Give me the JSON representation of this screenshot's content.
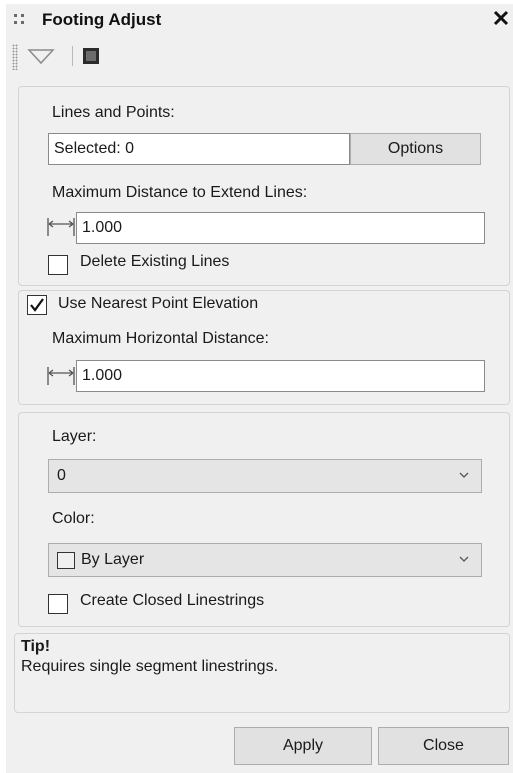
{
  "window": {
    "title": "Footing Adjust",
    "close_glyph": "✕"
  },
  "toolbar": {
    "icons": [
      "filter-triangle-icon",
      "image-icon"
    ]
  },
  "lines_points": {
    "label": "Lines and Points:",
    "selected_value": "Selected: 0",
    "options_label": "Options",
    "max_extend_label": "Maximum Distance to Extend Lines:",
    "max_extend_value": "1.000",
    "delete_label": "Delete Existing Lines",
    "delete_checked": false
  },
  "elevation": {
    "use_nearest_label": "Use Nearest Point Elevation",
    "use_nearest_checked": true,
    "max_horizontal_label": "Maximum Horizontal Distance:",
    "max_horizontal_value": "1.000"
  },
  "output": {
    "layer_label": "Layer:",
    "layer_value": "0",
    "color_label": "Color:",
    "color_value": "By Layer",
    "closed_label": "Create Closed Linestrings",
    "closed_checked": false
  },
  "tip": {
    "title": "Tip!",
    "text": "Requires single segment linestrings."
  },
  "footer": {
    "apply_label": "Apply",
    "close_label": "Close"
  }
}
